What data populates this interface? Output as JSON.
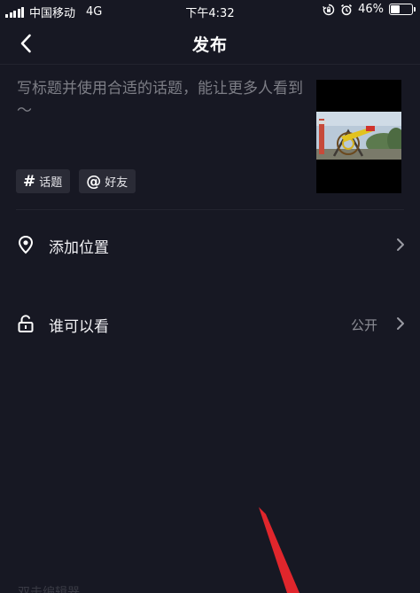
{
  "status_bar": {
    "carrier": "中国移动",
    "network": "4G",
    "time": "下午4:32",
    "battery_percent": "46%",
    "battery_level": 0.46,
    "icons": [
      "signal-icon",
      "orientation-lock-icon",
      "alarm-icon",
      "battery-icon"
    ]
  },
  "nav": {
    "title": "发布",
    "back_icon": "chevron-left-icon"
  },
  "post": {
    "caption_placeholder": "写标题并使用合适的话题，能让更多人看到～",
    "thumbnail_icon": "video-thumbnail"
  },
  "tags": [
    {
      "label": "话题",
      "icon": "#"
    },
    {
      "label": "好友",
      "icon": "@"
    }
  ],
  "options": [
    {
      "label": "添加位置",
      "value": "",
      "icon": "location-pin-icon"
    },
    {
      "label": "谁可以看",
      "value": "公开",
      "icon": "unlock-icon"
    }
  ],
  "bottom_text": "双击编辑器",
  "colors": {
    "background": "#171823",
    "tag_background": "#2a2b36",
    "placeholder": "#7d7e86",
    "secondary": "#8d8e96",
    "annotation_arrow": "#e0262c"
  }
}
